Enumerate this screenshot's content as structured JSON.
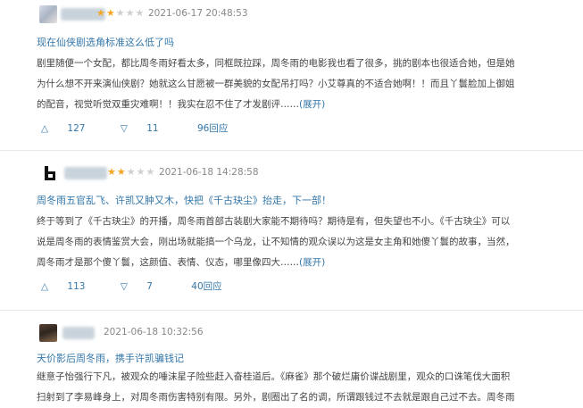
{
  "reviews": [
    {
      "stars_filled": 2,
      "date": "2021-06-17 20:48:53",
      "title": "现在仙侠剧选角标准这么低了吗",
      "body_lines": [
        "剧里随便一个女配，都比周冬雨好看太多，同框既拉踩，周冬雨的电影我也看了很多，挑的剧本也很适合她，但是她",
        "为什么想不开来演仙侠剧？她就这么甘愿被一群美貌的女配吊打吗？小艾尊真的不适合她啊！！而且丫鬟脸加上御姐",
        "的配音，视觉听觉双重灾难啊！！我实在忍不住了才发剧评……"
      ],
      "more": "(展开)",
      "up_votes": "127",
      "down_votes": "11",
      "replies": "96回应"
    },
    {
      "stars_filled": 2,
      "date": "2021-06-18 14:28:58",
      "title": "周冬雨五官乱飞、许凯又肿又木，快把《千古玦尘》抬走，下一部！",
      "body_lines": [
        "终于等到了《千古玦尘》的开播，周冬雨首部古装剧大家能不期待吗？期待是有，但失望也不小。《千古玦尘》可以",
        "说是周冬雨的表情鉴赏大会，刚出场就能搞一个乌龙，让不知情的观众误以为这是女主角和她傻丫鬟的故事，当然，",
        "周冬雨才是那个傻丫鬟，这颜值、表情、仪态，哪里像四大……"
      ],
      "more": "(展开)",
      "up_votes": "113",
      "down_votes": "7",
      "replies": "40回应"
    },
    {
      "date": "2021-06-18 10:32:56",
      "title": "天价影后周冬雨，携手许凯骗钱记",
      "body_lines": [
        "继意子怡强行下凡，被观众的唾沫星子险些赶入奋桂道后。《麻雀》那个破烂庸价谍战剧里，观众的口诛笔伐大面积",
        "扫射到了李易峰身上，对周冬雨伤害特别有限。另外，剧圈出了名的调，所谓跟钱过不去就是跟自己过不去。周冬雨"
      ]
    }
  ],
  "colors": {
    "link": "#3377aa",
    "star": "#f5a623"
  }
}
